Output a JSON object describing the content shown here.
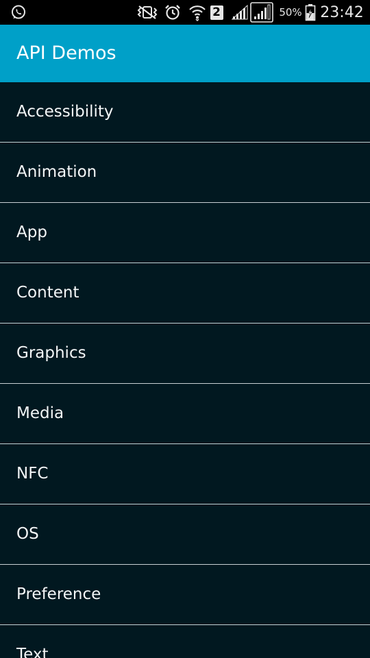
{
  "status_bar": {
    "icons": [
      "whatsapp-icon",
      "vibrate-mute-icon",
      "alarm-icon",
      "wifi-icon",
      "sim-2-badge",
      "signal-icon",
      "signal-roaming-icon",
      "battery-charging-icon"
    ],
    "sim_badge": "2",
    "battery_percent": "50%",
    "time": "23:42"
  },
  "app_bar": {
    "title": "API Demos",
    "color": "#00a0c8"
  },
  "list": {
    "background": "#011820",
    "items": [
      {
        "label": "Accessibility"
      },
      {
        "label": "Animation"
      },
      {
        "label": "App"
      },
      {
        "label": "Content"
      },
      {
        "label": "Graphics"
      },
      {
        "label": "Media"
      },
      {
        "label": "NFC"
      },
      {
        "label": "OS"
      },
      {
        "label": "Preference"
      },
      {
        "label": "Text"
      }
    ]
  }
}
